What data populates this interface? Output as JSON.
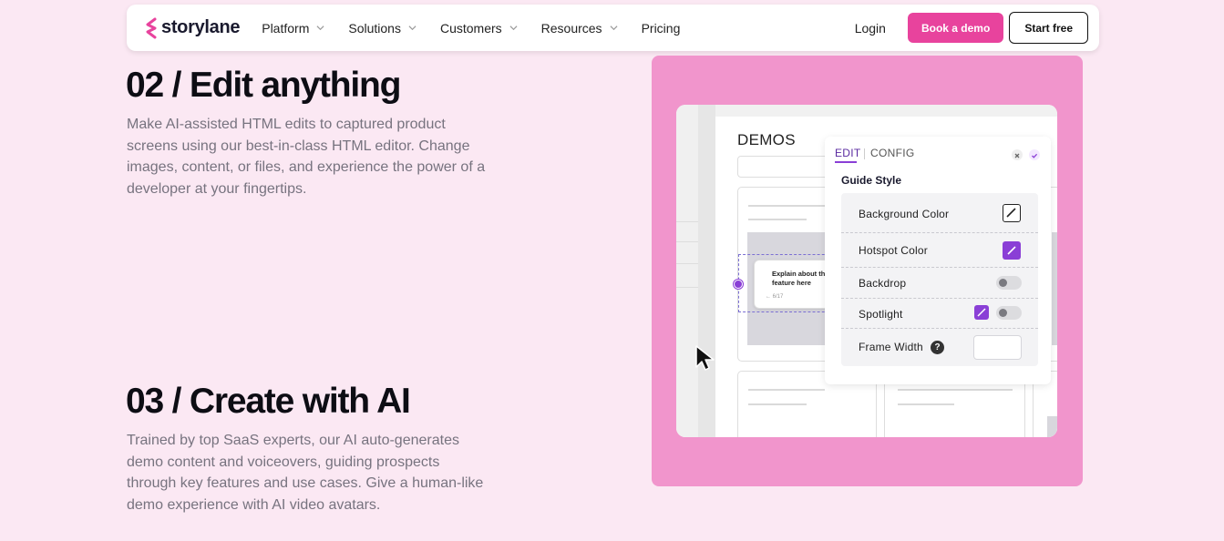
{
  "nav": {
    "brand": "storylane",
    "items": [
      {
        "label": "Platform",
        "has_dropdown": true
      },
      {
        "label": "Solutions",
        "has_dropdown": true
      },
      {
        "label": "Customers",
        "has_dropdown": true
      },
      {
        "label": "Resources",
        "has_dropdown": true
      },
      {
        "label": "Pricing",
        "has_dropdown": false
      }
    ],
    "login": "Login",
    "book_demo": "Book a demo",
    "start_free": "Start free"
  },
  "section_edit": {
    "title": "02 / Edit anything",
    "body": "Make AI-assisted HTML edits to captured product screens using our best-in-class HTML editor. Change images, content, or files, and experience the power of a developer at your fingertips."
  },
  "section_ai": {
    "title": "03 / Create with AI",
    "body": "Trained by top SaaS experts, our AI auto-generates demo content and voiceovers, guiding prospects through key features and use cases. Give a human-like demo experience with AI video avatars."
  },
  "mockup": {
    "demos_label": "DEMOS",
    "tooltip_text": "Explain about th feature here",
    "tooltip_count": "← 6/17",
    "panel": {
      "tab_edit": "EDIT",
      "tab_config": "CONFIG",
      "guide_style_title": "Guide Style",
      "rows": [
        {
          "label": "Background Color",
          "control": "swatch-white"
        },
        {
          "label": "Hotspot Color",
          "control": "swatch-purple"
        },
        {
          "label": "Backdrop",
          "control": "toggle"
        },
        {
          "label": "Spotlight",
          "control": "swatch-purple+toggle"
        },
        {
          "label": "Frame Width",
          "control": "help+input"
        }
      ],
      "help_glyph": "?"
    }
  },
  "colors": {
    "page_bg": "#fbe8f3",
    "brand_pink": "#e8439d",
    "card_pink": "#f195cc",
    "accent_purple": "#8a3fd6"
  },
  "icons": [
    "storylane-logo-icon",
    "chevron-down-icon",
    "pencil-icon",
    "close-icon",
    "check-icon",
    "help-icon",
    "cursor-arrow-icon"
  ]
}
